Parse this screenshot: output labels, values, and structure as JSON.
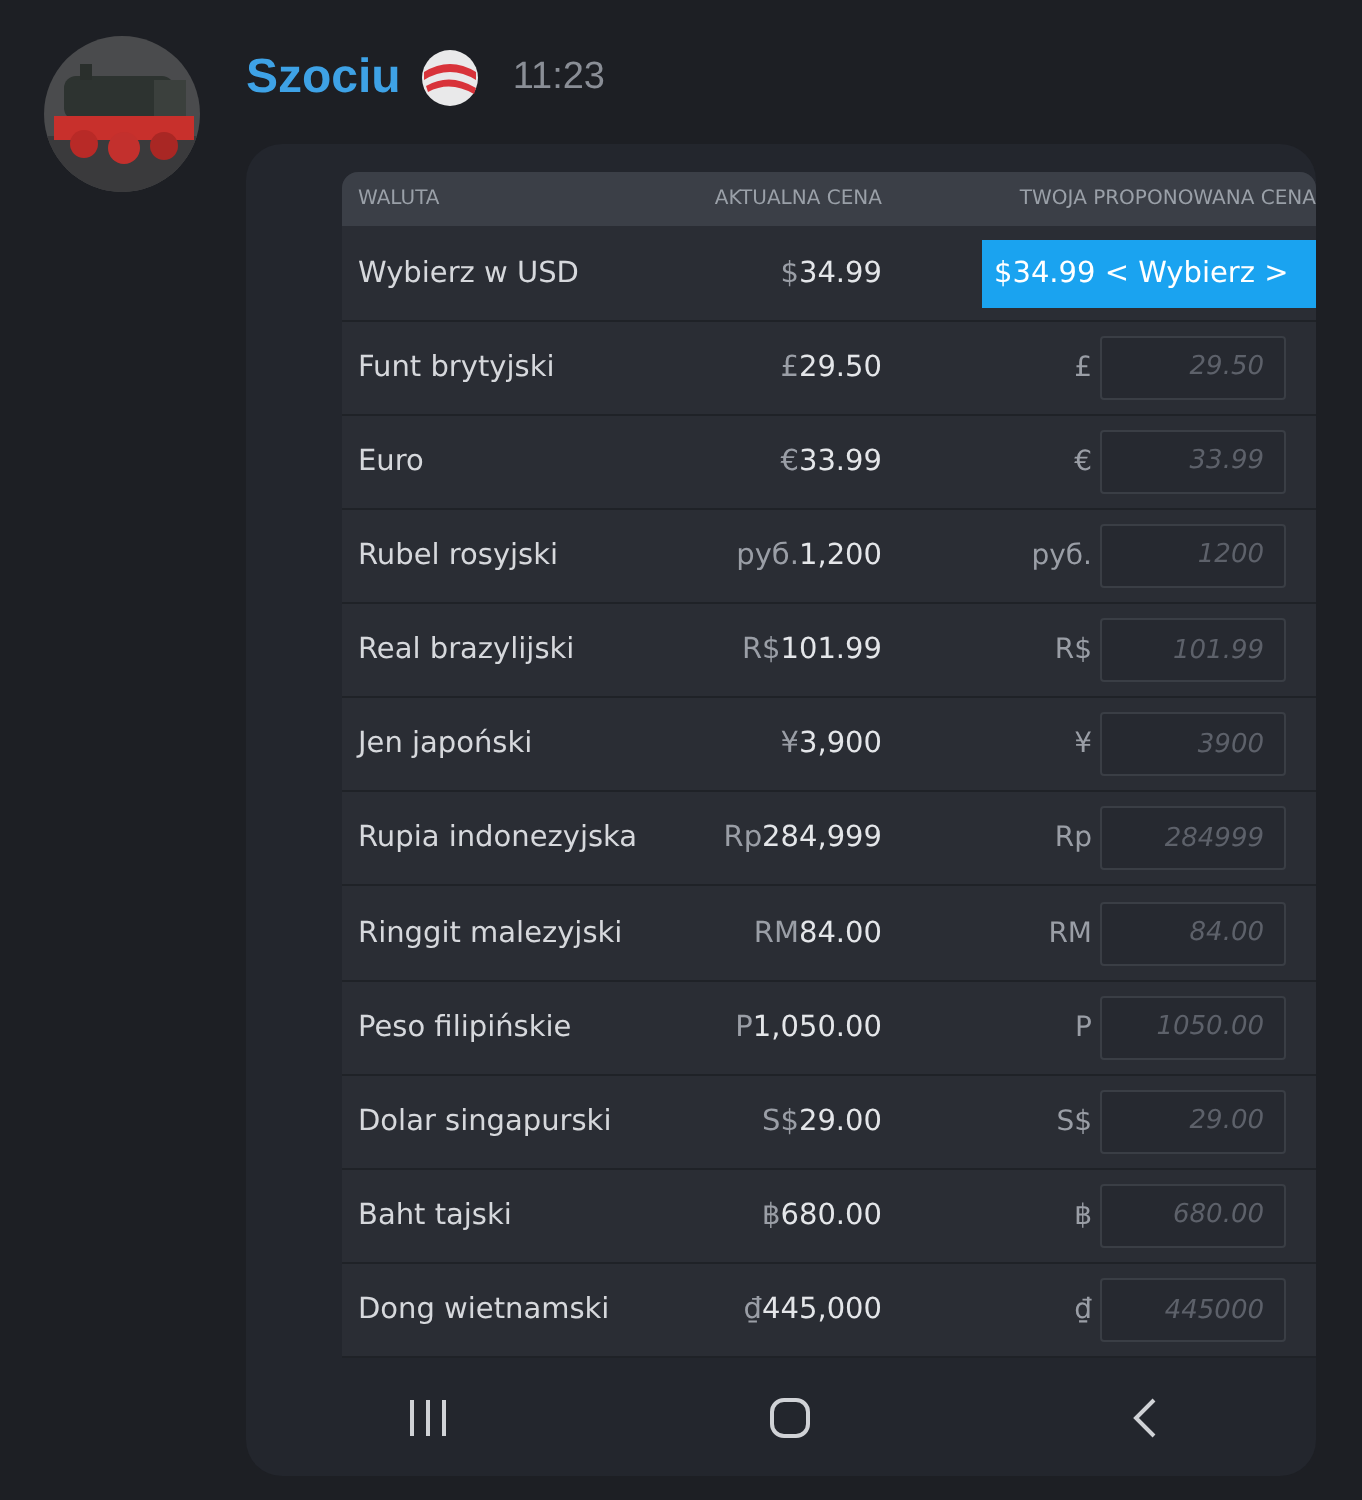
{
  "message": {
    "author": "Szociu",
    "time": "11:23"
  },
  "table": {
    "columns": [
      "WALUTA",
      "AKTUALNA CENA",
      "TWOJA PROPONOWANA CENA"
    ],
    "rows": [
      {
        "currency": "Wybierz w USD",
        "current_symbol": "$",
        "current_amount": "34.99",
        "kind": "select",
        "proposed": "$34.99 < Wybierz >"
      },
      {
        "currency": "Funt brytyjski",
        "current_symbol": "£",
        "current_amount": "29.50",
        "kind": "input",
        "symbol": "£",
        "placeholder": "29.50"
      },
      {
        "currency": "Euro",
        "current_symbol": "€",
        "current_amount": "33.99",
        "kind": "input",
        "symbol": "€",
        "placeholder": "33.99"
      },
      {
        "currency": "Rubel rosyjski",
        "current_symbol": "руб.",
        "current_amount": "1,200",
        "kind": "input",
        "symbol": "руб.",
        "placeholder": "1200"
      },
      {
        "currency": "Real brazylijski",
        "current_symbol": "R$",
        "current_amount": "101.99",
        "kind": "input",
        "symbol": "R$",
        "placeholder": "101.99"
      },
      {
        "currency": "Jen japoński",
        "current_symbol": "¥",
        "current_amount": "3,900",
        "kind": "input",
        "symbol": "¥",
        "placeholder": "3900"
      },
      {
        "currency": "Rupia indonezyjska",
        "current_symbol": "Rp",
        "current_amount": "284,999",
        "kind": "input",
        "symbol": "Rp",
        "placeholder": "284999"
      },
      {
        "currency": "Ringgit malezyjski",
        "current_symbol": "RM",
        "current_amount": "84.00",
        "kind": "input",
        "symbol": "RM",
        "placeholder": "84.00"
      },
      {
        "currency": "Peso filipińskie",
        "current_symbol": "P",
        "current_amount": "1,050.00",
        "kind": "input",
        "symbol": "P",
        "placeholder": "1050.00"
      },
      {
        "currency": "Dolar singapurski",
        "current_symbol": "S$",
        "current_amount": "29.00",
        "kind": "input",
        "symbol": "S$",
        "placeholder": "29.00"
      },
      {
        "currency": "Baht tajski",
        "current_symbol": "฿",
        "current_amount": "680.00",
        "kind": "input",
        "symbol": "฿",
        "placeholder": "680.00"
      },
      {
        "currency": "Dong wietnamski",
        "current_symbol": "₫",
        "current_amount": "445,000",
        "kind": "input",
        "symbol": "₫",
        "placeholder": "445000"
      }
    ]
  }
}
